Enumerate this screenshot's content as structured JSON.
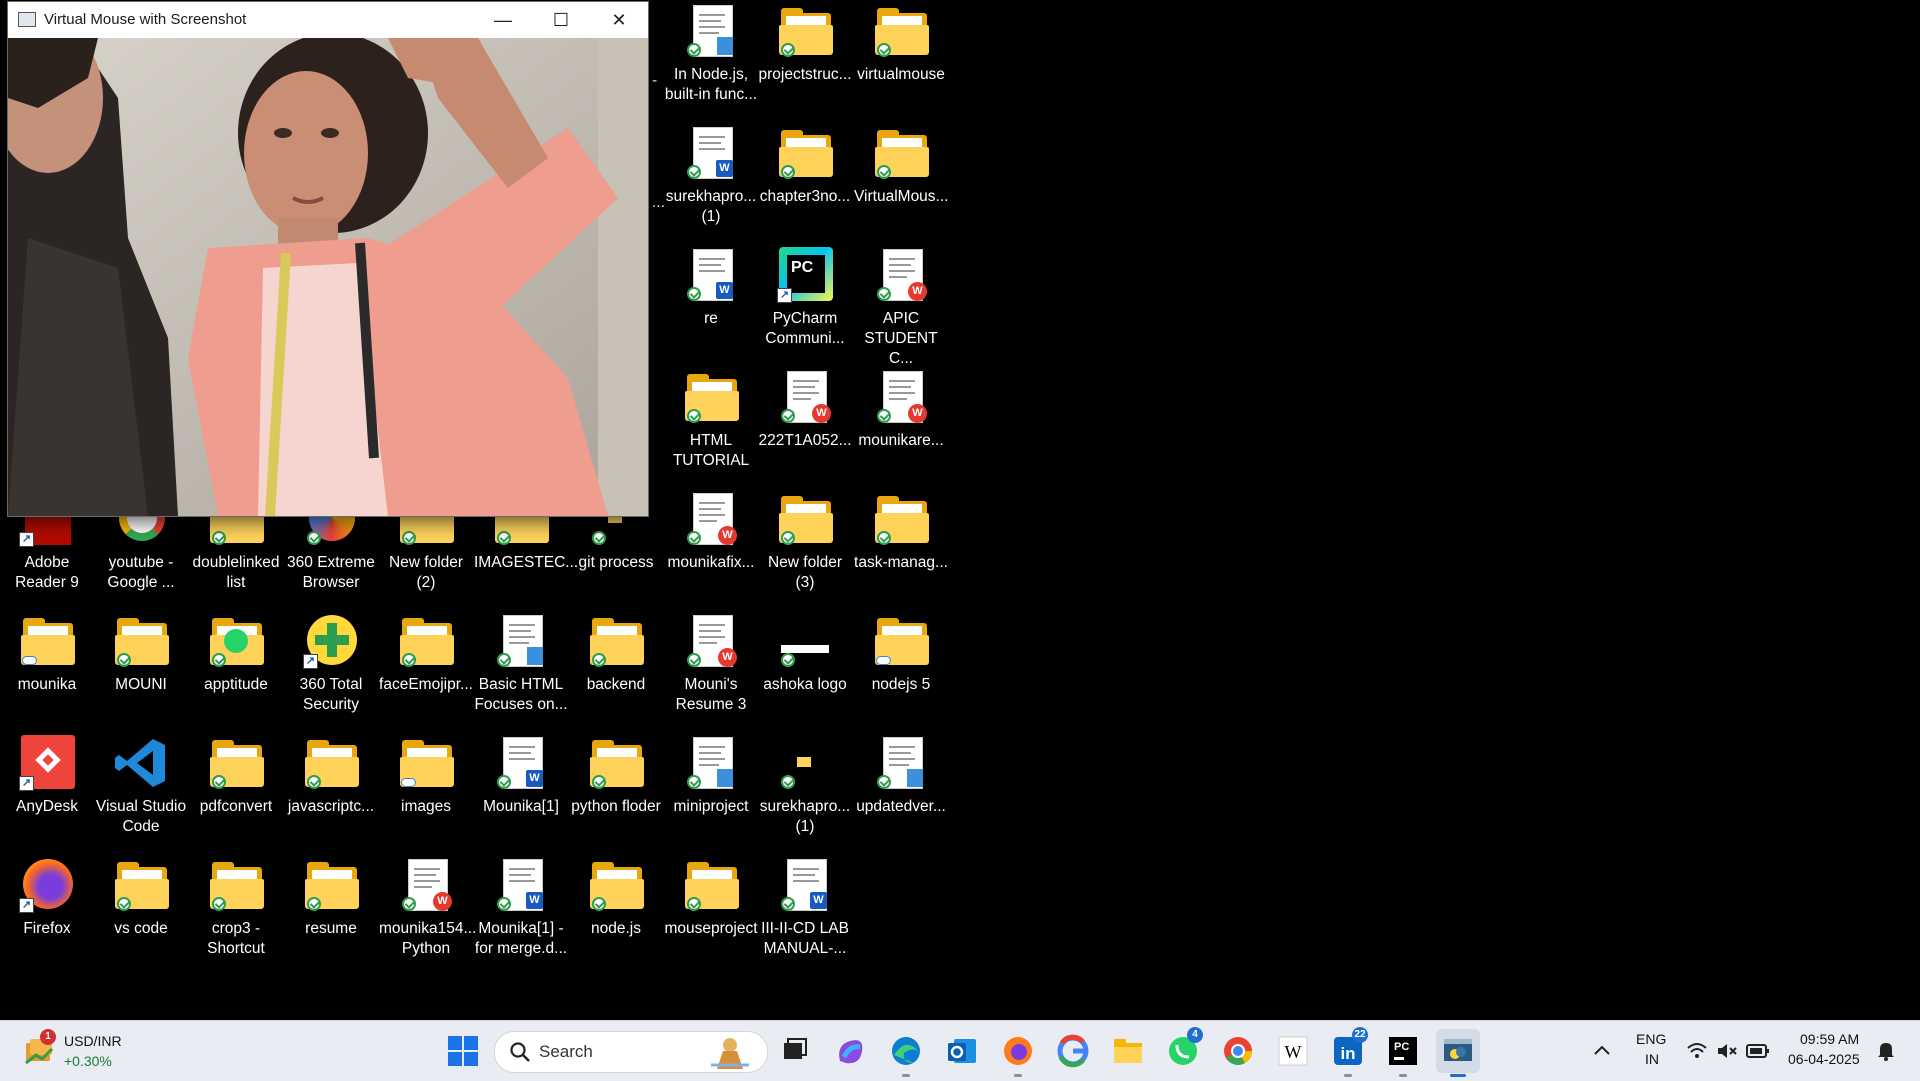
{
  "camera_window": {
    "title": "Virtual Mouse with Screenshot",
    "minimize_glyph": "—",
    "maximize_glyph": "☐",
    "close_glyph": "✕"
  },
  "desktop": {
    "cutoff_labels": [
      "-",
      "..."
    ],
    "icons": [
      {
        "label": "In Node.js, built-in func...",
        "kind": "doc-note"
      },
      {
        "label": "projectstruc...",
        "kind": "folder"
      },
      {
        "label": "virtualmouse",
        "kind": "folder"
      },
      {
        "label": "surekhapro... (1)",
        "kind": "doc-word"
      },
      {
        "label": "chapter3no...",
        "kind": "folder"
      },
      {
        "label": "VirtualMous...",
        "kind": "folder"
      },
      {
        "label": "re",
        "kind": "doc-word"
      },
      {
        "label": "PyCharm Communi...",
        "kind": "pycharm"
      },
      {
        "label": "APIC STUDENT C...",
        "kind": "doc-wps"
      },
      {
        "label": "HTML TUTORIAL",
        "kind": "folder"
      },
      {
        "label": "222T1A052...",
        "kind": "doc-wps"
      },
      {
        "label": "mounikare...",
        "kind": "doc-wps"
      },
      {
        "label": "Adobe Reader 9",
        "kind": "adobe"
      },
      {
        "label": "youtube - Google ...",
        "kind": "google"
      },
      {
        "label": "doublelinked list",
        "kind": "folder"
      },
      {
        "label": "360 Extreme Browser",
        "kind": "browser360"
      },
      {
        "label": "New folder (2)",
        "kind": "folder"
      },
      {
        "label": "IMAGESTEC...",
        "kind": "folder"
      },
      {
        "label": "git process",
        "kind": "folder-small"
      },
      {
        "label": "mounikafix...",
        "kind": "doc-wps"
      },
      {
        "label": "New folder (3)",
        "kind": "folder"
      },
      {
        "label": "task-manag...",
        "kind": "folder"
      },
      {
        "label": "mounika",
        "kind": "folder"
      },
      {
        "label": "MOUNI",
        "kind": "folder"
      },
      {
        "label": "apptitude",
        "kind": "folder-whatsapp"
      },
      {
        "label": "360 Total Security",
        "kind": "security360"
      },
      {
        "label": "faceEmojipr...",
        "kind": "folder"
      },
      {
        "label": "Basic HTML Focuses on...",
        "kind": "doc-note"
      },
      {
        "label": "backend",
        "kind": "folder"
      },
      {
        "label": "Mouni's Resume 3",
        "kind": "doc-wps"
      },
      {
        "label": "ashoka logo",
        "kind": "image"
      },
      {
        "label": "nodejs 5",
        "kind": "folder"
      },
      {
        "label": "AnyDesk",
        "kind": "anydesk"
      },
      {
        "label": "Visual Studio Code",
        "kind": "vscode"
      },
      {
        "label": "pdfconvert",
        "kind": "folder"
      },
      {
        "label": "javascriptc...",
        "kind": "folder"
      },
      {
        "label": "images",
        "kind": "folder"
      },
      {
        "label": "Mounika[1]",
        "kind": "doc-word"
      },
      {
        "label": "python floder",
        "kind": "folder"
      },
      {
        "label": "miniproject",
        "kind": "doc-note"
      },
      {
        "label": "surekhapro... (1)",
        "kind": "folder-small"
      },
      {
        "label": "updatedver...",
        "kind": "doc-note"
      },
      {
        "label": "Firefox",
        "kind": "firefox"
      },
      {
        "label": "vs code",
        "kind": "folder"
      },
      {
        "label": "crop3 - Shortcut",
        "kind": "folder"
      },
      {
        "label": "resume",
        "kind": "folder"
      },
      {
        "label": "mounika154... Python",
        "kind": "doc-wps"
      },
      {
        "label": "Mounika[1] - for merge.d...",
        "kind": "doc-word"
      },
      {
        "label": "node.js",
        "kind": "folder"
      },
      {
        "label": "mouseproject",
        "kind": "folder"
      },
      {
        "label": "III-II-CD LAB MANUAL-...",
        "kind": "doc-word"
      }
    ]
  },
  "taskbar": {
    "widget": {
      "title": "USD/INR",
      "change": "+0.30%",
      "badge": "1"
    },
    "search_placeholder": "Search",
    "apps": [
      {
        "name": "task-view"
      },
      {
        "name": "copilot"
      },
      {
        "name": "edge"
      },
      {
        "name": "outlook"
      },
      {
        "name": "firefox"
      },
      {
        "name": "google"
      },
      {
        "name": "file-explorer"
      },
      {
        "name": "whatsapp",
        "badge": "4"
      },
      {
        "name": "chrome"
      },
      {
        "name": "wikipedia"
      },
      {
        "name": "linkedin",
        "badge": "22"
      },
      {
        "name": "pycharm"
      },
      {
        "name": "python-app"
      }
    ],
    "lang_top": "ENG",
    "lang_bottom": "IN",
    "time": "09:59 AM",
    "date": "06-04-2025"
  },
  "colors": {
    "folder": "#ffd35a",
    "taskbar_bg": "#e9edf3",
    "accent_blue": "#1f6fd1"
  }
}
